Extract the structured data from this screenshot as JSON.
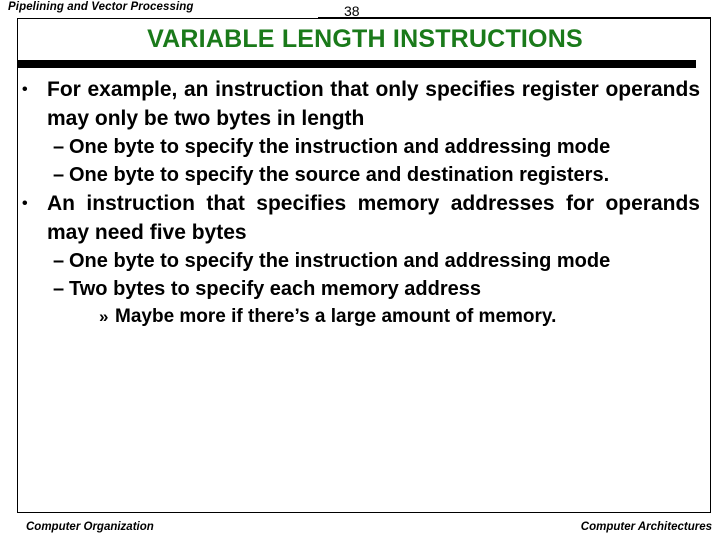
{
  "header": {
    "course_title": "Pipelining and Vector Processing",
    "page_number": "38"
  },
  "slide": {
    "title": "VARIABLE LENGTH INSTRUCTIONS",
    "title_color": "#1a7a1a",
    "bullets": [
      {
        "level": 1,
        "marker": "•",
        "text": "For example, an instruction that only specifies register operands may only be two bytes in length"
      },
      {
        "level": 2,
        "marker": "–",
        "text": "One byte to specify the instruction and addressing mode"
      },
      {
        "level": 2,
        "marker": "–",
        "text": "One byte to specify the source and destination registers."
      },
      {
        "level": 1,
        "marker": "•",
        "text": "An instruction that specifies memory addresses for operands may need five bytes"
      },
      {
        "level": 2,
        "marker": "–",
        "text": "One byte to specify the instruction and addressing mode"
      },
      {
        "level": 2,
        "marker": "–",
        "text": "Two bytes to specify each memory address"
      },
      {
        "level": 3,
        "marker": "»",
        "text": "Maybe more if there’s a large amount of memory."
      }
    ]
  },
  "footer": {
    "left": "Computer Organization",
    "right": "Computer Architectures"
  }
}
